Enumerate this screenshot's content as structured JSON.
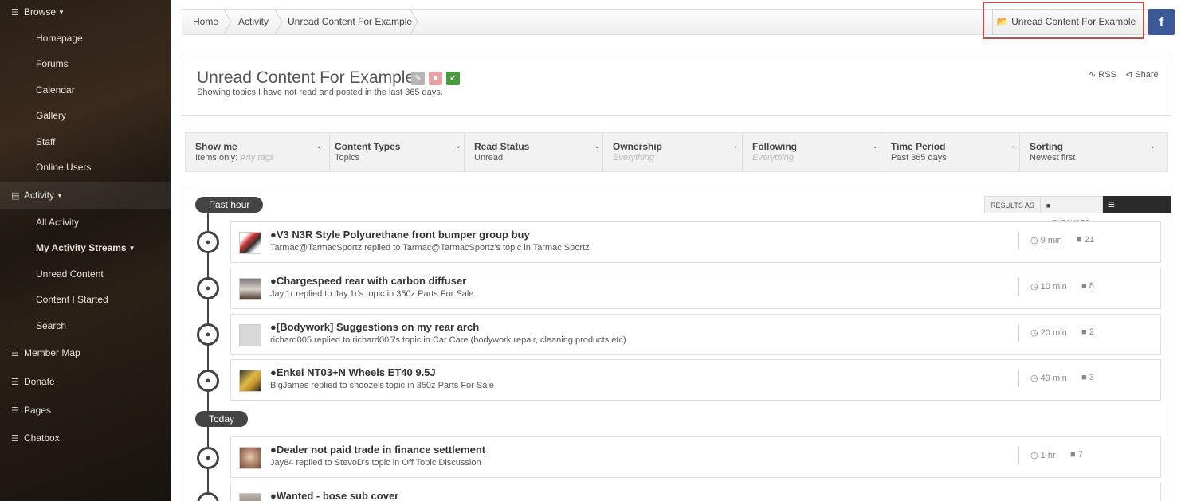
{
  "sidebar": {
    "browse_label": "Browse",
    "browse_items": [
      "Homepage",
      "Forums",
      "Calendar",
      "Gallery",
      "Staff",
      "Online Users"
    ],
    "activity_label": "Activity",
    "activity_items": [
      "All Activity",
      "My Activity Streams",
      "Unread Content",
      "Content I Started",
      "Search"
    ],
    "bottom_items": [
      "Member Map",
      "Donate",
      "Pages",
      "Chatbox"
    ]
  },
  "breadcrumb": [
    "Home",
    "Activity",
    "Unread Content For Example"
  ],
  "action_button_label": "Unread Content For Example",
  "facebook_label": "f",
  "header": {
    "title": "Unread Content For Example",
    "subtitle": "Showing topics I have not read and posted in the last 365 days.",
    "rss_label": "RSS",
    "share_label": "Share"
  },
  "filters": [
    {
      "title": "Show me",
      "value_prefix": "Items only:",
      "value": "Any tags",
      "muted": true
    },
    {
      "title": "Content Types",
      "value_prefix": "",
      "value": "Topics",
      "muted": false
    },
    {
      "title": "Read Status",
      "value_prefix": "",
      "value": "Unread",
      "muted": false
    },
    {
      "title": "Ownership",
      "value_prefix": "",
      "value": "Everything",
      "muted": true
    },
    {
      "title": "Following",
      "value_prefix": "",
      "value": "Everything",
      "muted": true
    },
    {
      "title": "Time Period",
      "value_prefix": "",
      "value": "Past 365 days",
      "muted": false
    },
    {
      "title": "Sorting",
      "value_prefix": "",
      "value": "Newest first",
      "muted": false
    }
  ],
  "results_as": {
    "label": "Results as",
    "expanded": "Expanded",
    "condensed": "Condensed"
  },
  "groups": [
    {
      "label": "Past hour"
    },
    {
      "label": "Today"
    }
  ],
  "items": [
    {
      "title": "V3 N3R Style Polyurethane front bumper group buy",
      "sub": "Tarmac@TarmacSportz replied to Tarmac@TarmacSportz's topic in Tarmac Sportz",
      "time": "9 min",
      "count": "21"
    },
    {
      "title": "Chargespeed rear with carbon diffuser",
      "sub": "Jay.1r replied to Jay.1r's topic in 350z Parts For Sale",
      "time": "10 min",
      "count": "8"
    },
    {
      "title": "[Bodywork] Suggestions on my rear arch",
      "sub": "richard005 replied to richard005's topic in Car Care (bodywork repair, cleaning products etc)",
      "time": "20 min",
      "count": "2"
    },
    {
      "title": "Enkei NT03+N Wheels ET40 9.5J",
      "sub": "BigJames replied to shooze's topic in 350z Parts For Sale",
      "time": "49 min",
      "count": "3"
    },
    {
      "title": "Dealer not paid trade in finance settlement",
      "sub": "Jay84 replied to StevoD's topic in Off Topic Discussion",
      "time": "1 hr",
      "count": "7"
    },
    {
      "title": "Wanted - bose sub cover",
      "sub": "",
      "time": "",
      "count": ""
    }
  ],
  "colors": {
    "accent_dark": "#444444",
    "highlight_border": "#c0504d",
    "facebook": "#3b5998",
    "edit_btn": "#b5b5b5",
    "delete_btn": "#e7a3a3",
    "ok_btn": "#4a9b3d"
  }
}
